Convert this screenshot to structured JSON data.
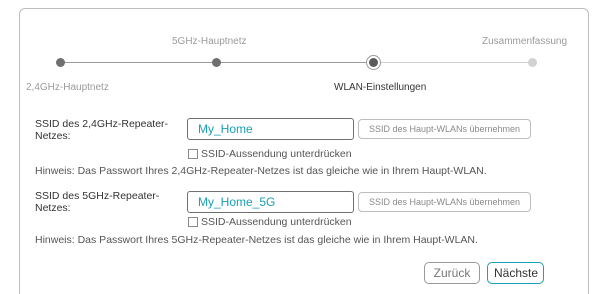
{
  "stepper": {
    "steps": [
      {
        "label": "2,4GHz-Hauptnetz",
        "state": "done"
      },
      {
        "label": "5GHz-Hauptnetz",
        "state": "done"
      },
      {
        "label": "WLAN-Einstellungen",
        "state": "current"
      },
      {
        "label": "Zusammenfassung",
        "state": "pending"
      }
    ]
  },
  "ssid_24": {
    "label": "SSID des 2,4GHz-Repeater-Netzes:",
    "value": "My_Home",
    "copy_button": "SSID des Haupt-WLANs übernehmen",
    "hide_checkbox_label": "SSID-Aussendung unterdrücken",
    "hint": "Hinweis: Das Passwort Ihres 2,4GHz-Repeater-Netzes ist das gleiche wie in Ihrem Haupt-WLAN."
  },
  "ssid_5": {
    "label": "SSID des 5GHz-Repeater-Netzes:",
    "value": "My_Home_5G",
    "copy_button": "SSID des Haupt-WLANs übernehmen",
    "hide_checkbox_label": "SSID-Aussendung unterdrücken",
    "hint": "Hinweis: Das Passwort Ihres 5GHz-Repeater-Netzes ist das gleiche wie in Ihrem Haupt-WLAN."
  },
  "footer": {
    "back_label": "Zurück",
    "next_label": "Nächste"
  },
  "colors": {
    "accent": "#1a9fb5",
    "step_done": "#6f6f6f",
    "step_pending": "#d2d2d2"
  }
}
